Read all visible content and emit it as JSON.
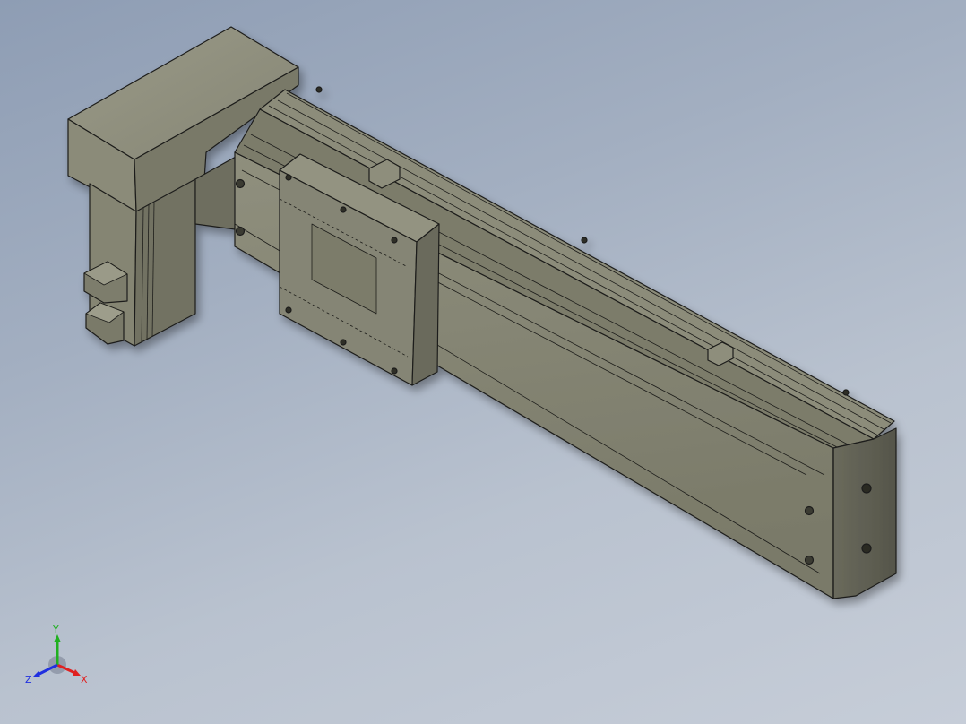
{
  "viewport": {
    "background_top": "#8e9db4",
    "background_bottom": "#c6cdd8"
  },
  "model": {
    "body_color": "#8a8a78",
    "shade_color": "#5e5e52",
    "highlight_color": "#a2a290",
    "edge_color": "#1e1e1a"
  },
  "triad": {
    "x_label": "X",
    "y_label": "Y",
    "z_label": "Z",
    "x_color": "#e02020",
    "y_color": "#20b020",
    "z_color": "#2030e0"
  }
}
